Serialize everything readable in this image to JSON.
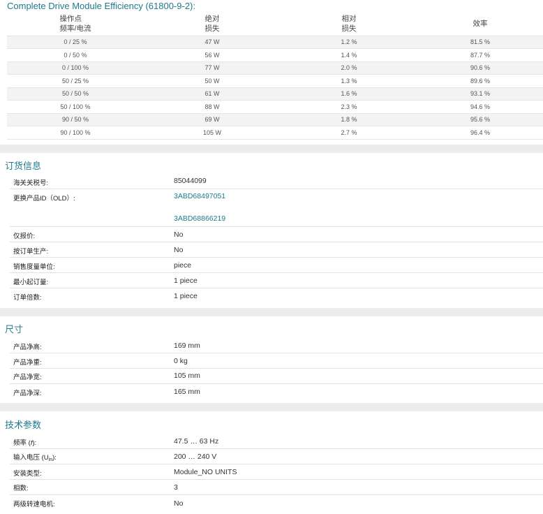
{
  "efficiency": {
    "title": "Complete Drive Module Efficiency (61800-9-2):",
    "headers": [
      {
        "line1": "操作点",
        "line2": "频率/电流"
      },
      {
        "line1": "绝对",
        "line2": "损失"
      },
      {
        "line1": "相对",
        "line2": "损失"
      },
      {
        "line1": "效率",
        "line2": ""
      }
    ],
    "rows": [
      [
        "0 / 25 %",
        "47 W",
        "1.2 %",
        "81.5 %"
      ],
      [
        "0 / 50 %",
        "56 W",
        "1.4 %",
        "87.7 %"
      ],
      [
        "0 / 100 %",
        "77 W",
        "2.0 %",
        "90.6 %"
      ],
      [
        "50 / 25 %",
        "50 W",
        "1.3 %",
        "89.6 %"
      ],
      [
        "50 / 50 %",
        "61 W",
        "1.6 %",
        "93.1 %"
      ],
      [
        "50 / 100 %",
        "88 W",
        "2.3 %",
        "94.6 %"
      ],
      [
        "90 / 50 %",
        "69 W",
        "1.8 %",
        "95.6 %"
      ],
      [
        "90 / 100 %",
        "105 W",
        "2.7 %",
        "96.4 %"
      ]
    ]
  },
  "ordering": {
    "title": "订货信息",
    "customs_label": "海关关税号:",
    "customs_value": "85044099",
    "replacement_label": "更换产品ID（OLD）:",
    "replacement_links": [
      "3ABD68497051",
      "3ABD68866219"
    ],
    "quote_only_label": "仅报价:",
    "quote_only_value": "No",
    "make_to_order_label": "按订单生产:",
    "make_to_order_value": "No",
    "uom_label": "销售度量单位:",
    "uom_value": "piece",
    "moq_label": "最小起订量:",
    "moq_value": "1 piece",
    "multiple_label": "订单倍数:",
    "multiple_value": "1 piece"
  },
  "dimensions": {
    "title": "尺寸",
    "height_label": "产品净高:",
    "height_value": "169 mm",
    "weight_label": "产品净重:",
    "weight_value": "0 kg",
    "width_label": "产品净宽:",
    "width_value": "105 mm",
    "depth_label": "产品净深:",
    "depth_value": "165 mm"
  },
  "technical": {
    "title": "技术参数",
    "freq_label": "频率 (",
    "freq_symbol": "f",
    "freq_label_end": "):",
    "freq_value": "47.5 … 63 Hz",
    "voltage_label": "输入电压 (U",
    "voltage_sub": "in",
    "voltage_label_end": "):",
    "voltage_value": "200 … 240 V",
    "mounting_label": "安装类型:",
    "mounting_value": "Module_NO UNITS",
    "phases_label": "相数:",
    "phases_value": "3",
    "twospeed_label": "两级转速电机:",
    "twospeed_value": "No"
  }
}
